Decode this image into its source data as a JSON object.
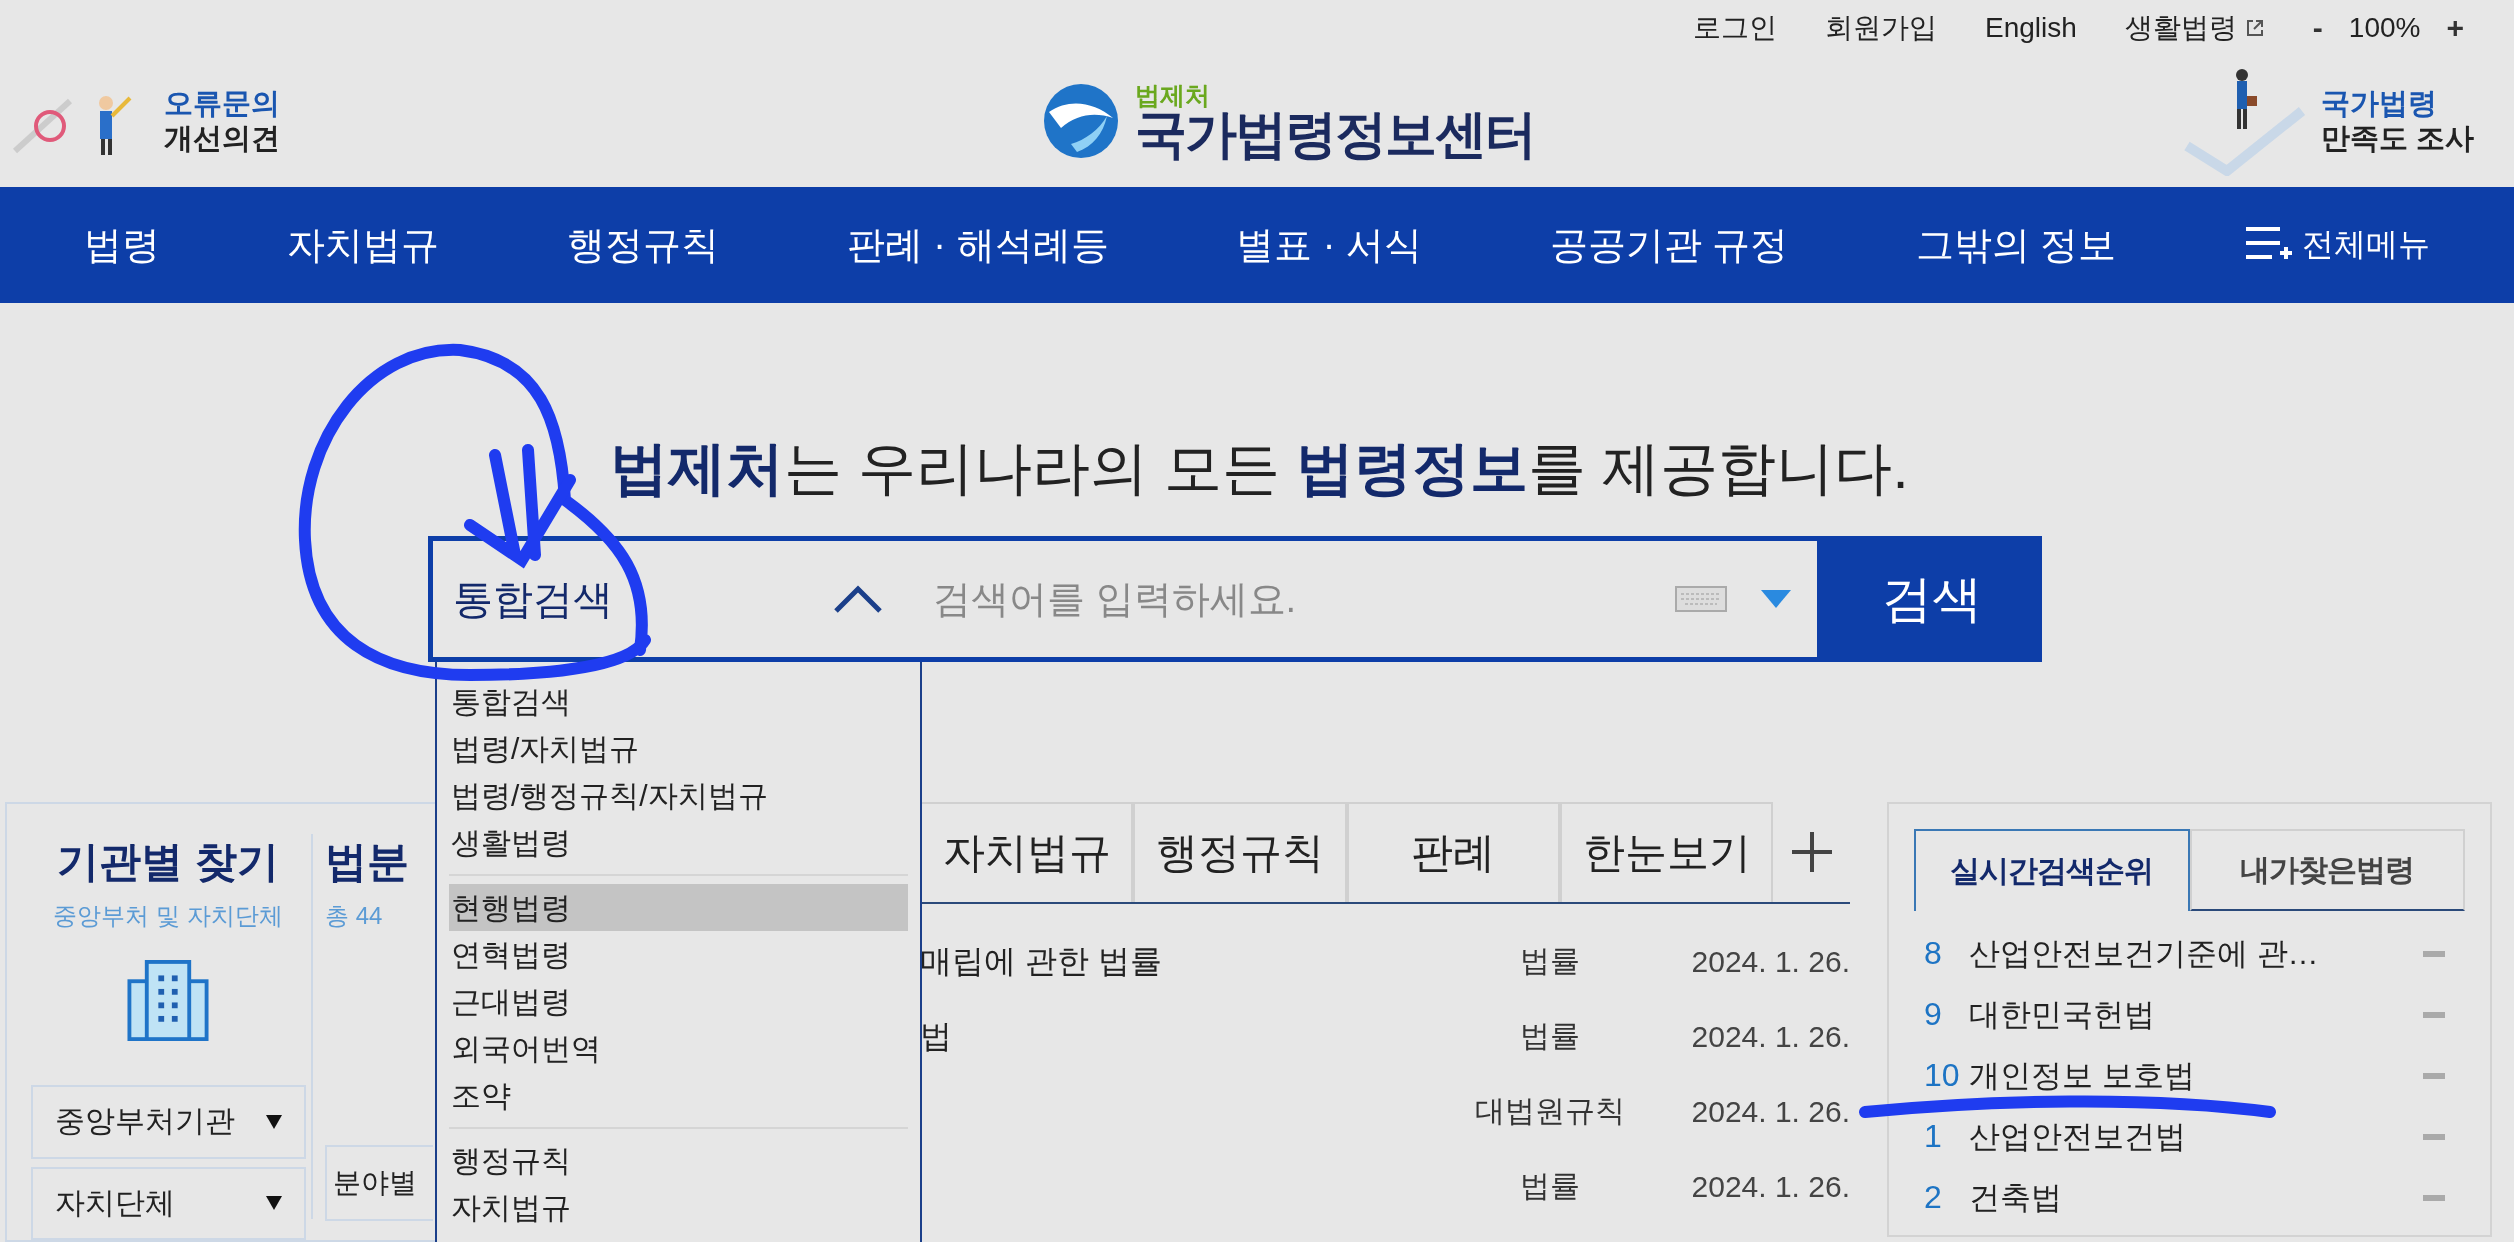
{
  "utility_bar": {
    "links": [
      "로그인",
      "회원가입",
      "English",
      "생활법령"
    ],
    "zoom": {
      "minus": "-",
      "value": "100%",
      "plus": "+"
    }
  },
  "header": {
    "feedback": [
      "오류문의",
      "개선의견"
    ],
    "logo": {
      "org": "법제처",
      "title": "국가법령정보센터"
    },
    "survey": [
      "국가법령",
      "만족도 조사"
    ]
  },
  "nav": {
    "items": [
      "법령",
      "자치법규",
      "행정규칙",
      "판례 · 해석례등",
      "별표 · 서식",
      "공공기관 규정",
      "그밖의 정보"
    ],
    "all_menu": "전체메뉴"
  },
  "headline": "**법제처**는 우리나라의 모든 **법령정보**를 제공합니다.",
  "search": {
    "scope": "통합검색",
    "expanded": true,
    "placeholder": "검색어를 입력하세요.",
    "button": "검색",
    "dropdown": [
      [
        {
          "label": "통합검색",
          "selected": false
        },
        {
          "label": "법령/자치법규",
          "selected": false
        },
        {
          "label": "법령/행정규칙/자치법규",
          "selected": false
        },
        {
          "label": "생활법령",
          "selected": false
        }
      ],
      [
        {
          "label": "현행법령",
          "selected": true
        },
        {
          "label": "연혁법령",
          "selected": false
        },
        {
          "label": "근대법령",
          "selected": false
        },
        {
          "label": "외국어번역",
          "selected": false
        },
        {
          "label": "조약",
          "selected": false
        }
      ],
      [
        {
          "label": "행정규칙",
          "selected": false
        },
        {
          "label": "자치법규",
          "selected": false
        }
      ]
    ]
  },
  "agency_finder": {
    "title": "기관별 찾기",
    "subtitle": "중앙부처 및 자치단체",
    "selects": [
      "중앙부처기관",
      "자치단체"
    ]
  },
  "field_finder": {
    "title": "법분",
    "subtitle": "총 44",
    "select": "분야별"
  },
  "recent": {
    "tabs": [
      {
        "label": "자치법규",
        "selected": false
      },
      {
        "label": "행정규칙",
        "selected": false
      },
      {
        "label": "판례",
        "selected": false
      },
      {
        "label": "한눈보기",
        "selected": false
      }
    ],
    "rows": [
      {
        "title": "매립에 관한 법률",
        "type": "법률",
        "date": "2024. 1. 26."
      },
      {
        "title": "법",
        "type": "법률",
        "date": "2024. 1. 26."
      },
      {
        "title": "",
        "type": "대법원규칙",
        "date": "2024. 1. 26."
      },
      {
        "title": "",
        "type": "법률",
        "date": "2024. 1. 26."
      }
    ]
  },
  "ranking": {
    "tabs": [
      {
        "label": "실시간검색순위",
        "selected": true
      },
      {
        "label": "내가찾은법령",
        "selected": false
      }
    ],
    "items": [
      {
        "rank": "8",
        "name": "산업안전보건기준에 관…"
      },
      {
        "rank": "9",
        "name": "대한민국헌법"
      },
      {
        "rank": "10",
        "name": "개인정보 보호법"
      },
      {
        "rank": "1",
        "name": "산업안전보건법"
      },
      {
        "rank": "2",
        "name": "건축법"
      }
    ]
  }
}
